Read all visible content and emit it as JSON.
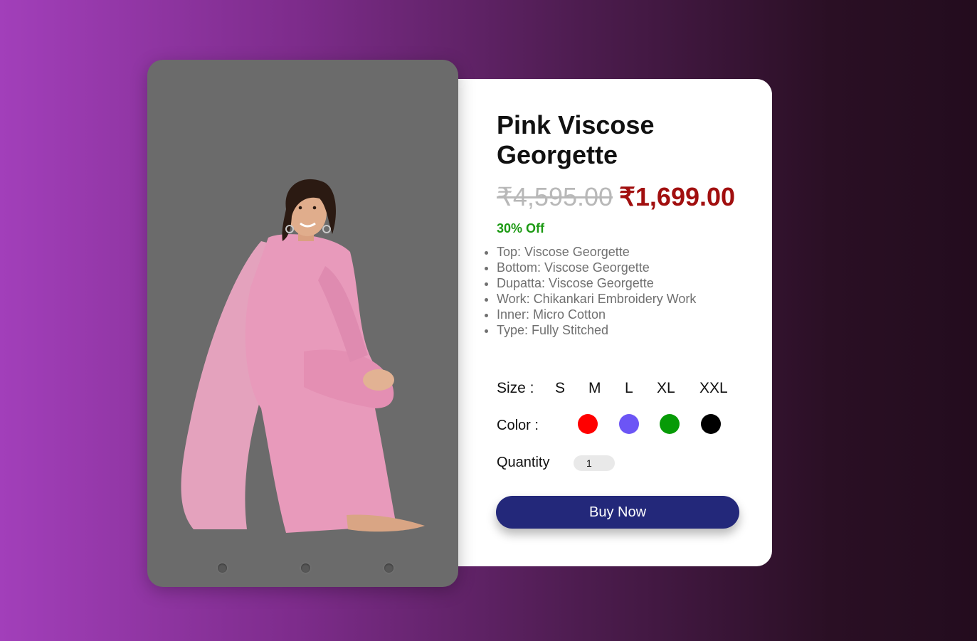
{
  "product": {
    "title": "Pink Viscose Georgette",
    "old_price": "₹4,595.00",
    "new_price": "₹1,699.00",
    "discount": "30% Off",
    "features": [
      "Top: Viscose Georgette",
      "Bottom: Viscose Georgette",
      "Dupatta: Viscose Georgette",
      "Work: Chikankari Embroidery Work",
      "Inner: Micro Cotton",
      "Type: Fully Stitched"
    ]
  },
  "size": {
    "label": "Size :",
    "options": [
      "S",
      "M",
      "L",
      "XL",
      "XXL"
    ]
  },
  "color": {
    "label": "Color :",
    "swatches": [
      "#ff0000",
      "#6c55f5",
      "#079b07",
      "#000000"
    ]
  },
  "quantity": {
    "label": "Quantity",
    "value": "1"
  },
  "buy_button": "Buy Now",
  "colors": {
    "price_accent": "#a10f0f",
    "discount": "#1d9a14",
    "button": "#23287a",
    "image_card_bg": "#6b6b6b"
  },
  "carousel": {
    "dot_count": 3
  }
}
